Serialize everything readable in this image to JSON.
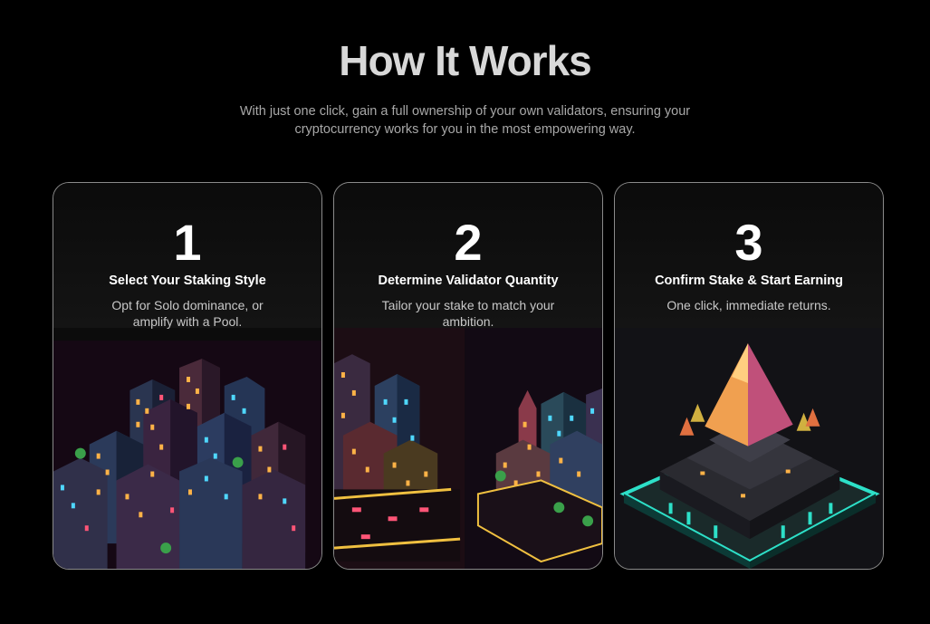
{
  "section": {
    "title": "How It Works",
    "subtitle": "With just one click, gain a full ownership of your own validators, ensuring your cryptocurrency works for you in the most empowering way."
  },
  "steps": [
    {
      "number": "1",
      "title": "Select Your Staking Style",
      "description": "Opt for Solo dominance, or amplify with a Pool.",
      "illustration": "isometric-neon-city-illustration"
    },
    {
      "number": "2",
      "title": "Determine Validator Quantity",
      "description": "Tailor your stake to match your ambition.",
      "illustration": "twin-isometric-cities-illustration"
    },
    {
      "number": "3",
      "title": "Confirm Stake & Start Earning",
      "description": "One click, immediate returns.",
      "illustration": "isometric-pyramid-platform-illustration"
    }
  ],
  "colors": {
    "background": "#000000",
    "card_border": "#8a8a8a",
    "neon_cyan": "#2de0c8",
    "neon_orange": "#ff8a3c",
    "neon_pink": "#e0407a"
  }
}
